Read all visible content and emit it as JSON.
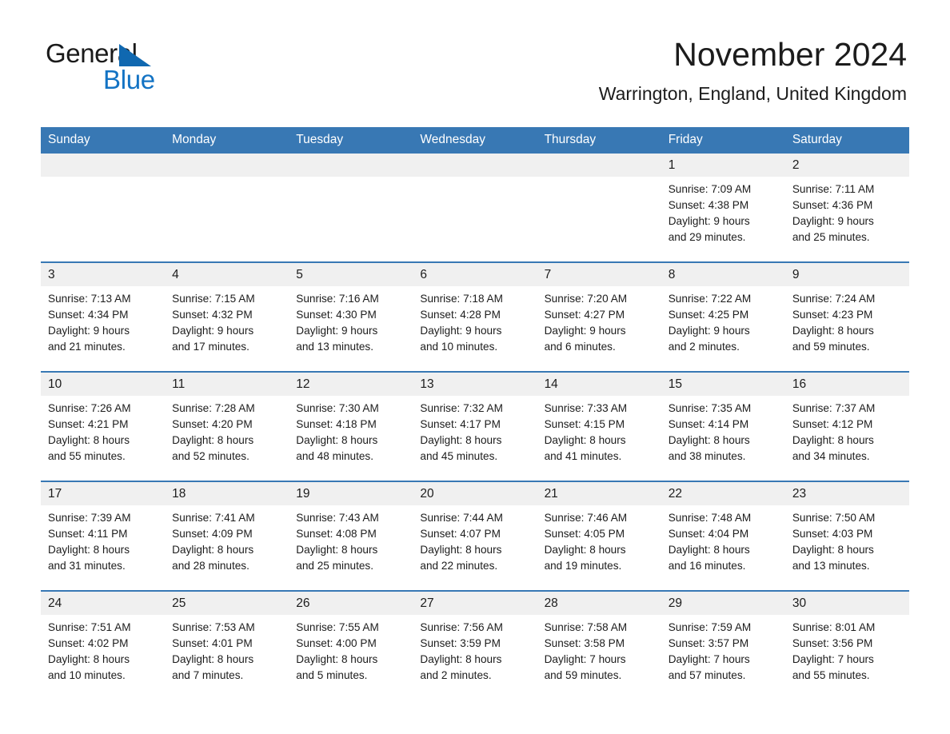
{
  "brand": {
    "name_part1": "General",
    "name_part2": "Blue"
  },
  "header": {
    "title": "November 2024",
    "location": "Warrington, England, United Kingdom"
  },
  "colors": {
    "header_blue": "#3878b4",
    "daynum_band": "#f0f0f0",
    "brand_blue": "#1373c4",
    "text": "#1c1c1c"
  },
  "weekday_headers": [
    "Sunday",
    "Monday",
    "Tuesday",
    "Wednesday",
    "Thursday",
    "Friday",
    "Saturday"
  ],
  "weeks": [
    [
      {
        "day": "",
        "blank": true
      },
      {
        "day": "",
        "blank": true
      },
      {
        "day": "",
        "blank": true
      },
      {
        "day": "",
        "blank": true
      },
      {
        "day": "",
        "blank": true
      },
      {
        "day": "1",
        "sunrise": "Sunrise: 7:09 AM",
        "sunset": "Sunset: 4:38 PM",
        "daylight1": "Daylight: 9 hours",
        "daylight2": "and 29 minutes."
      },
      {
        "day": "2",
        "sunrise": "Sunrise: 7:11 AM",
        "sunset": "Sunset: 4:36 PM",
        "daylight1": "Daylight: 9 hours",
        "daylight2": "and 25 minutes."
      }
    ],
    [
      {
        "day": "3",
        "sunrise": "Sunrise: 7:13 AM",
        "sunset": "Sunset: 4:34 PM",
        "daylight1": "Daylight: 9 hours",
        "daylight2": "and 21 minutes."
      },
      {
        "day": "4",
        "sunrise": "Sunrise: 7:15 AM",
        "sunset": "Sunset: 4:32 PM",
        "daylight1": "Daylight: 9 hours",
        "daylight2": "and 17 minutes."
      },
      {
        "day": "5",
        "sunrise": "Sunrise: 7:16 AM",
        "sunset": "Sunset: 4:30 PM",
        "daylight1": "Daylight: 9 hours",
        "daylight2": "and 13 minutes."
      },
      {
        "day": "6",
        "sunrise": "Sunrise: 7:18 AM",
        "sunset": "Sunset: 4:28 PM",
        "daylight1": "Daylight: 9 hours",
        "daylight2": "and 10 minutes."
      },
      {
        "day": "7",
        "sunrise": "Sunrise: 7:20 AM",
        "sunset": "Sunset: 4:27 PM",
        "daylight1": "Daylight: 9 hours",
        "daylight2": "and 6 minutes."
      },
      {
        "day": "8",
        "sunrise": "Sunrise: 7:22 AM",
        "sunset": "Sunset: 4:25 PM",
        "daylight1": "Daylight: 9 hours",
        "daylight2": "and 2 minutes."
      },
      {
        "day": "9",
        "sunrise": "Sunrise: 7:24 AM",
        "sunset": "Sunset: 4:23 PM",
        "daylight1": "Daylight: 8 hours",
        "daylight2": "and 59 minutes."
      }
    ],
    [
      {
        "day": "10",
        "sunrise": "Sunrise: 7:26 AM",
        "sunset": "Sunset: 4:21 PM",
        "daylight1": "Daylight: 8 hours",
        "daylight2": "and 55 minutes."
      },
      {
        "day": "11",
        "sunrise": "Sunrise: 7:28 AM",
        "sunset": "Sunset: 4:20 PM",
        "daylight1": "Daylight: 8 hours",
        "daylight2": "and 52 minutes."
      },
      {
        "day": "12",
        "sunrise": "Sunrise: 7:30 AM",
        "sunset": "Sunset: 4:18 PM",
        "daylight1": "Daylight: 8 hours",
        "daylight2": "and 48 minutes."
      },
      {
        "day": "13",
        "sunrise": "Sunrise: 7:32 AM",
        "sunset": "Sunset: 4:17 PM",
        "daylight1": "Daylight: 8 hours",
        "daylight2": "and 45 minutes."
      },
      {
        "day": "14",
        "sunrise": "Sunrise: 7:33 AM",
        "sunset": "Sunset: 4:15 PM",
        "daylight1": "Daylight: 8 hours",
        "daylight2": "and 41 minutes."
      },
      {
        "day": "15",
        "sunrise": "Sunrise: 7:35 AM",
        "sunset": "Sunset: 4:14 PM",
        "daylight1": "Daylight: 8 hours",
        "daylight2": "and 38 minutes."
      },
      {
        "day": "16",
        "sunrise": "Sunrise: 7:37 AM",
        "sunset": "Sunset: 4:12 PM",
        "daylight1": "Daylight: 8 hours",
        "daylight2": "and 34 minutes."
      }
    ],
    [
      {
        "day": "17",
        "sunrise": "Sunrise: 7:39 AM",
        "sunset": "Sunset: 4:11 PM",
        "daylight1": "Daylight: 8 hours",
        "daylight2": "and 31 minutes."
      },
      {
        "day": "18",
        "sunrise": "Sunrise: 7:41 AM",
        "sunset": "Sunset: 4:09 PM",
        "daylight1": "Daylight: 8 hours",
        "daylight2": "and 28 minutes."
      },
      {
        "day": "19",
        "sunrise": "Sunrise: 7:43 AM",
        "sunset": "Sunset: 4:08 PM",
        "daylight1": "Daylight: 8 hours",
        "daylight2": "and 25 minutes."
      },
      {
        "day": "20",
        "sunrise": "Sunrise: 7:44 AM",
        "sunset": "Sunset: 4:07 PM",
        "daylight1": "Daylight: 8 hours",
        "daylight2": "and 22 minutes."
      },
      {
        "day": "21",
        "sunrise": "Sunrise: 7:46 AM",
        "sunset": "Sunset: 4:05 PM",
        "daylight1": "Daylight: 8 hours",
        "daylight2": "and 19 minutes."
      },
      {
        "day": "22",
        "sunrise": "Sunrise: 7:48 AM",
        "sunset": "Sunset: 4:04 PM",
        "daylight1": "Daylight: 8 hours",
        "daylight2": "and 16 minutes."
      },
      {
        "day": "23",
        "sunrise": "Sunrise: 7:50 AM",
        "sunset": "Sunset: 4:03 PM",
        "daylight1": "Daylight: 8 hours",
        "daylight2": "and 13 minutes."
      }
    ],
    [
      {
        "day": "24",
        "sunrise": "Sunrise: 7:51 AM",
        "sunset": "Sunset: 4:02 PM",
        "daylight1": "Daylight: 8 hours",
        "daylight2": "and 10 minutes."
      },
      {
        "day": "25",
        "sunrise": "Sunrise: 7:53 AM",
        "sunset": "Sunset: 4:01 PM",
        "daylight1": "Daylight: 8 hours",
        "daylight2": "and 7 minutes."
      },
      {
        "day": "26",
        "sunrise": "Sunrise: 7:55 AM",
        "sunset": "Sunset: 4:00 PM",
        "daylight1": "Daylight: 8 hours",
        "daylight2": "and 5 minutes."
      },
      {
        "day": "27",
        "sunrise": "Sunrise: 7:56 AM",
        "sunset": "Sunset: 3:59 PM",
        "daylight1": "Daylight: 8 hours",
        "daylight2": "and 2 minutes."
      },
      {
        "day": "28",
        "sunrise": "Sunrise: 7:58 AM",
        "sunset": "Sunset: 3:58 PM",
        "daylight1": "Daylight: 7 hours",
        "daylight2": "and 59 minutes."
      },
      {
        "day": "29",
        "sunrise": "Sunrise: 7:59 AM",
        "sunset": "Sunset: 3:57 PM",
        "daylight1": "Daylight: 7 hours",
        "daylight2": "and 57 minutes."
      },
      {
        "day": "30",
        "sunrise": "Sunrise: 8:01 AM",
        "sunset": "Sunset: 3:56 PM",
        "daylight1": "Daylight: 7 hours",
        "daylight2": "and 55 minutes."
      }
    ]
  ]
}
